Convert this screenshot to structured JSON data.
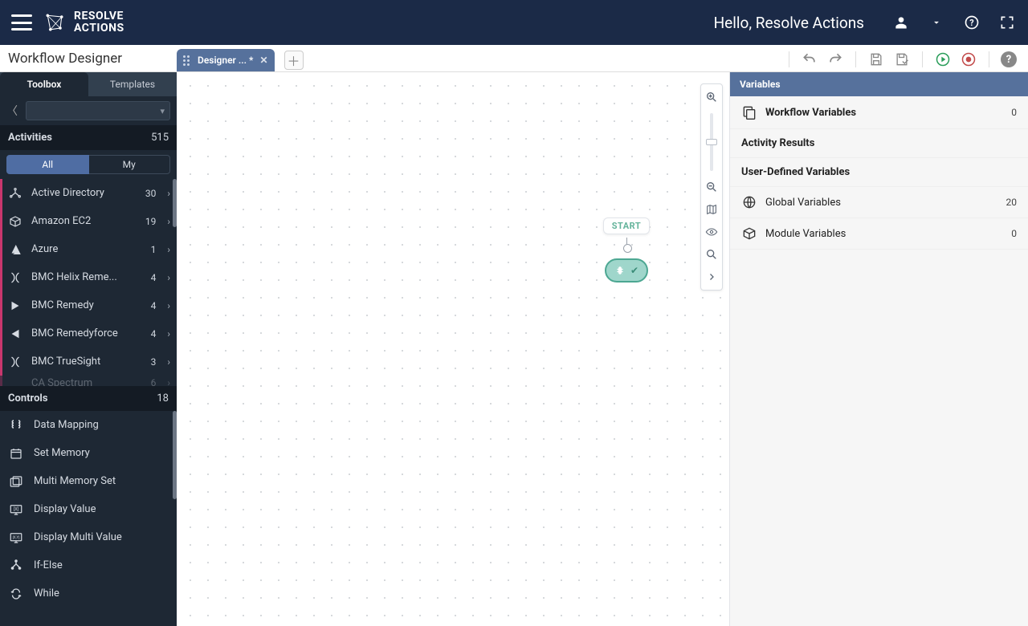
{
  "appbar": {
    "brand_line1": "RESOLVE",
    "brand_line2": "ACTIONS",
    "greeting": "Hello, Resolve Actions"
  },
  "subbar": {
    "title": "Workflow Designer",
    "tab_label": "Designer ... *"
  },
  "sidebar": {
    "tab_toolbox": "Toolbox",
    "tab_templates": "Templates",
    "activities_header": "Activities",
    "activities_count": "515",
    "pill_all": "All",
    "pill_my": "My",
    "activities": [
      {
        "label": "Active Directory",
        "count": "30"
      },
      {
        "label": "Amazon EC2",
        "count": "19"
      },
      {
        "label": "Azure",
        "count": "1"
      },
      {
        "label": "BMC Helix Reme...",
        "count": "4"
      },
      {
        "label": "BMC Remedy",
        "count": "4"
      },
      {
        "label": "BMC Remedyforce",
        "count": "4"
      },
      {
        "label": "BMC TrueSight",
        "count": "3"
      },
      {
        "label": "CA Spectrum",
        "count": "6"
      }
    ],
    "controls_header": "Controls",
    "controls_count": "18",
    "controls": [
      {
        "label": "Data Mapping"
      },
      {
        "label": "Set Memory"
      },
      {
        "label": "Multi Memory Set"
      },
      {
        "label": "Display Value"
      },
      {
        "label": "Display Multi Value"
      },
      {
        "label": "If-Else"
      },
      {
        "label": "While"
      }
    ]
  },
  "canvas": {
    "start_label": "START"
  },
  "rightpanel": {
    "header": "Variables",
    "workflow_vars_label": "Workflow Variables",
    "workflow_vars_count": "0",
    "activity_results_label": "Activity Results",
    "user_defined_label": "User-Defined Variables",
    "global_vars_label": "Global Variables",
    "global_vars_count": "20",
    "module_vars_label": "Module Variables",
    "module_vars_count": "0"
  }
}
